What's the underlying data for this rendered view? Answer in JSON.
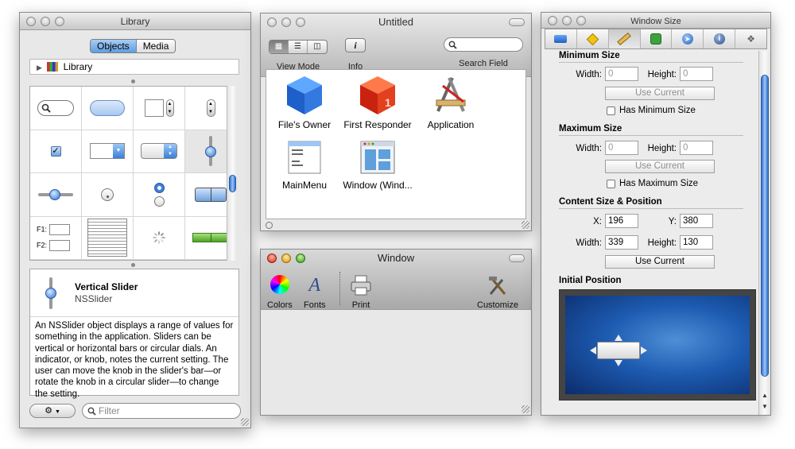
{
  "library": {
    "title": "Library",
    "tabs": [
      "Objects",
      "Media"
    ],
    "tree_item": "Library",
    "form_labels": [
      "F1:",
      "F2:"
    ],
    "selected": {
      "name": "Vertical Slider",
      "class": "NSSlider",
      "description": "An NSSlider object displays a range of values for something in the application. Sliders can be vertical or horizontal bars or circular dials. An indicator, or knob, notes the current setting. The user can move the knob in the slider's bar—or rotate the knob in a circular slider—to change the setting."
    },
    "filter_placeholder": "Filter"
  },
  "untitled": {
    "title": "Untitled",
    "toolbar": {
      "view_mode": "View Mode",
      "info": "Info",
      "search_field": "Search Field"
    },
    "objects": [
      {
        "label": "File's Owner"
      },
      {
        "label": "First Responder"
      },
      {
        "label": "Application"
      },
      {
        "label": "MainMenu"
      },
      {
        "label": "Window (Wind..."
      }
    ]
  },
  "window": {
    "title": "Window",
    "toolbar": {
      "colors": "Colors",
      "fonts": "Fonts",
      "print": "Print",
      "customize": "Customize"
    }
  },
  "inspector": {
    "title": "Window Size",
    "minimum": {
      "heading": "Minimum Size",
      "width_label": "Width:",
      "height_label": "Height:",
      "width": "0",
      "height": "0",
      "use_current": "Use Current",
      "checkbox": "Has Minimum Size"
    },
    "maximum": {
      "heading": "Maximum Size",
      "width_label": "Width:",
      "height_label": "Height:",
      "width": "0",
      "height": "0",
      "use_current": "Use Current",
      "checkbox": "Has Maximum Size"
    },
    "content": {
      "heading": "Content Size & Position",
      "x_label": "X:",
      "y_label": "Y:",
      "width_label": "Width:",
      "height_label": "Height:",
      "x": "196",
      "y": "380",
      "width": "339",
      "height": "130",
      "use_current": "Use Current"
    },
    "initial_position": {
      "heading": "Initial Position"
    }
  },
  "colors": {
    "accent_blue": "#3b7fd9",
    "selected_segment": "#7fb3ea",
    "close_red": "#d52d17",
    "minimize_yellow": "#d89a12",
    "zoom_green": "#3f9e1b"
  }
}
